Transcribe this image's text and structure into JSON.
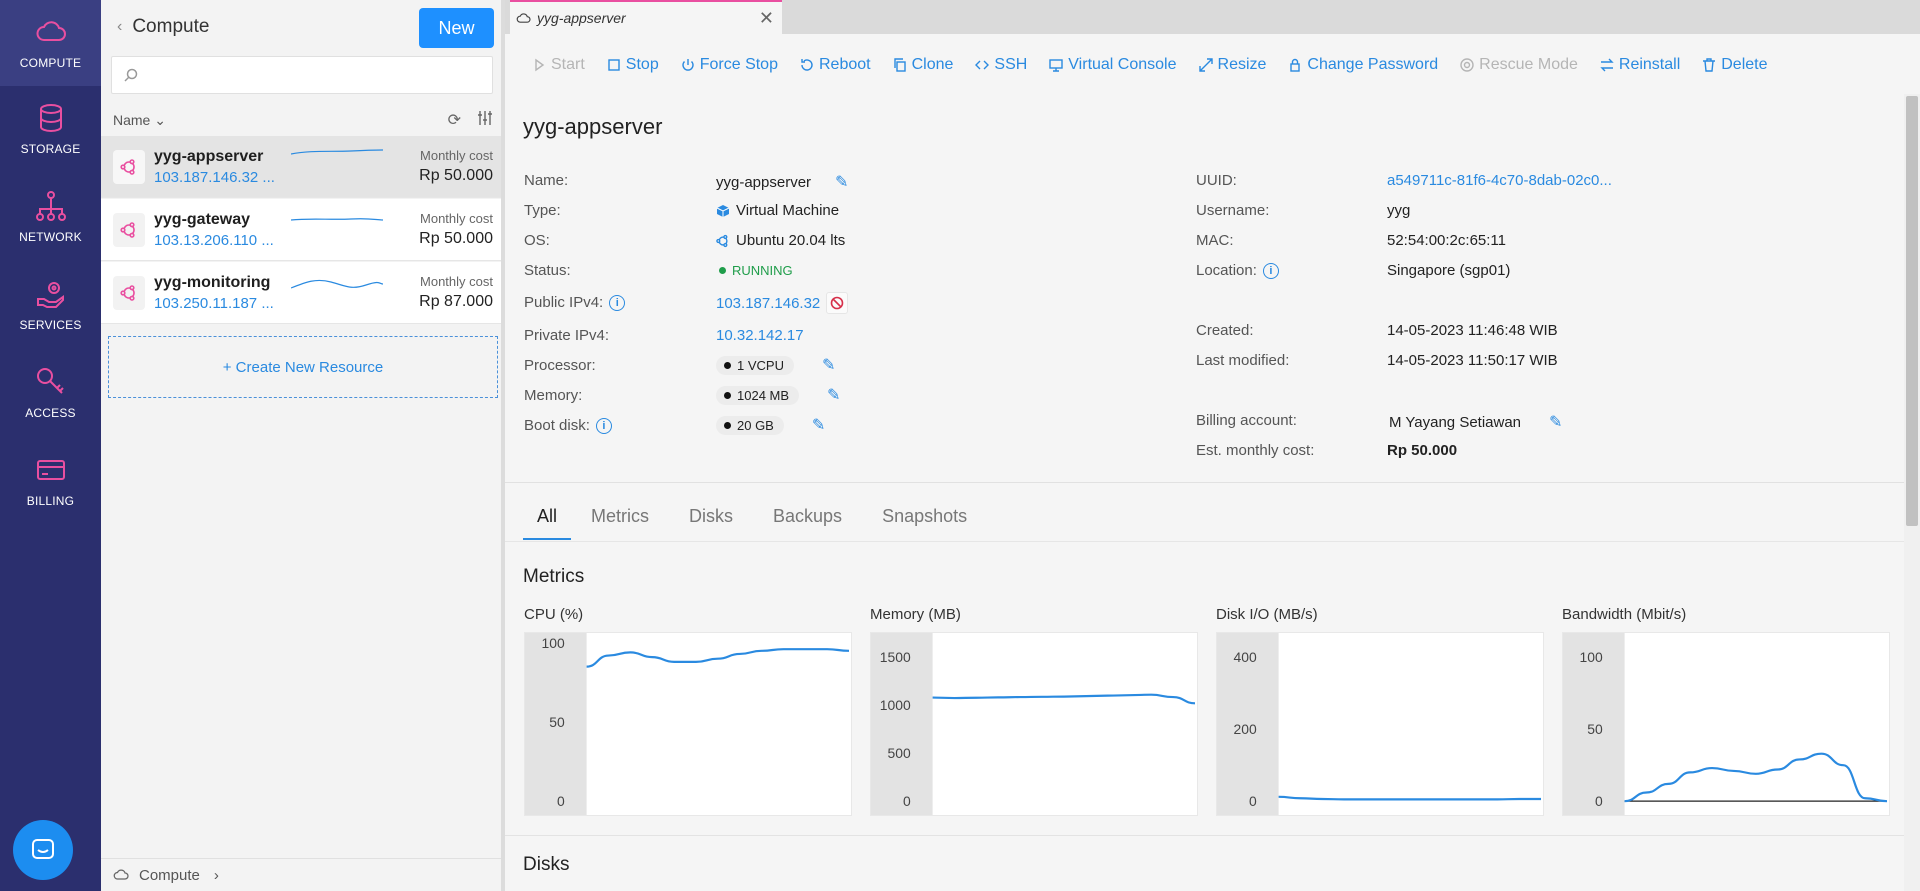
{
  "nav": {
    "items": [
      {
        "label": "COMPUTE",
        "icon": "cloud-icon",
        "active": true
      },
      {
        "label": "STORAGE",
        "icon": "database-icon"
      },
      {
        "label": "NETWORK",
        "icon": "network-icon"
      },
      {
        "label": "SERVICES",
        "icon": "hand-gear-icon"
      },
      {
        "label": "ACCESS",
        "icon": "key-icon"
      },
      {
        "label": "BILLING",
        "icon": "credit-card-icon"
      }
    ],
    "accent": "#e94fa0",
    "background": "#2b2f6e"
  },
  "list": {
    "title": "Compute",
    "new_label": "New",
    "search_placeholder": "",
    "sort_label": "Name",
    "create_label": "+ Create New Resource",
    "items": [
      {
        "name": "yyg-appserver",
        "ip": "103.187.146.32 ...",
        "cost_label": "Monthly cost",
        "cost": "Rp 50.000"
      },
      {
        "name": "yyg-gateway",
        "ip": "103.13.206.110 ...",
        "cost_label": "Monthly cost",
        "cost": "Rp 50.000"
      },
      {
        "name": "yyg-monitoring",
        "ip": "103.250.11.187 ...",
        "cost_label": "Monthly cost",
        "cost": "Rp 87.000"
      }
    ],
    "footer_breadcrumb": "Compute"
  },
  "tab": {
    "title": "yyg-appserver"
  },
  "toolbar": {
    "start": "Start",
    "stop": "Stop",
    "force_stop": "Force Stop",
    "reboot": "Reboot",
    "clone": "Clone",
    "ssh": "SSH",
    "virtual_console": "Virtual Console",
    "resize": "Resize",
    "change_password": "Change Password",
    "rescue_mode": "Rescue Mode",
    "reinstall": "Reinstall",
    "delete": "Delete"
  },
  "detail": {
    "title": "yyg-appserver",
    "left": {
      "name_label": "Name:",
      "name": "yyg-appserver",
      "type_label": "Type:",
      "type": "Virtual Machine",
      "os_label": "OS:",
      "os": "Ubuntu 20.04 lts",
      "status_label": "Status:",
      "status": "RUNNING",
      "public_ip_label": "Public IPv4:",
      "public_ip": "103.187.146.32",
      "private_ip_label": "Private IPv4:",
      "private_ip": "10.32.142.17",
      "processor_label": "Processor:",
      "processor": "1 VCPU",
      "memory_label": "Memory:",
      "memory": "1024 MB",
      "boot_disk_label": "Boot disk:",
      "boot_disk": "20 GB"
    },
    "right": {
      "uuid_label": "UUID:",
      "uuid": "a549711c-81f6-4c70-8dab-02c0...",
      "username_label": "Username:",
      "username": "yyg",
      "mac_label": "MAC:",
      "mac": "52:54:00:2c:65:11",
      "location_label": "Location:",
      "location": "Singapore (sgp01)",
      "created_label": "Created:",
      "created": "14-05-2023 11:46:48 WIB",
      "modified_label": "Last modified:",
      "modified": "14-05-2023 11:50:17 WIB",
      "billing_label": "Billing account:",
      "billing": "M Yayang Setiawan",
      "cost_label": "Est. monthly cost:",
      "cost": "Rp 50.000"
    }
  },
  "subtabs": [
    "All",
    "Metrics",
    "Disks",
    "Backups",
    "Snapshots"
  ],
  "sections": {
    "metrics": "Metrics",
    "disks": "Disks"
  },
  "metrics": [
    {
      "title": "CPU (%)",
      "ticks": [
        "100",
        "50",
        "0"
      ],
      "ymax": 100,
      "values": [
        85,
        92,
        94,
        91,
        88,
        88,
        90,
        93,
        95,
        96,
        96,
        96,
        95
      ]
    },
    {
      "title": "Memory (MB)",
      "ticks": [
        "1500",
        "1000",
        "500",
        "0"
      ],
      "ymax": 1650,
      "values": [
        1080,
        1075,
        1078,
        1082,
        1085,
        1088,
        1090,
        1095,
        1100,
        1105,
        1110,
        1085,
        1020
      ]
    },
    {
      "title": "Disk I/O (MB/s)",
      "ticks": [
        "400",
        "200",
        "0"
      ],
      "ymax": 440,
      "values": [
        12,
        8,
        6,
        5,
        5,
        5,
        5,
        5,
        5,
        5,
        5,
        6,
        6
      ]
    },
    {
      "title": "Bandwidth (Mbit/s)",
      "ticks": [
        "100",
        "50",
        "0"
      ],
      "ymax": 110,
      "values": [
        0,
        6,
        12,
        20,
        23,
        21,
        19,
        22,
        29,
        33,
        25,
        2,
        0
      ]
    }
  ],
  "colors": {
    "link": "#2a8ae0",
    "primary_button": "#1e90ff",
    "running": "#1f9d4a",
    "chart_line": "#2a8ae0"
  }
}
